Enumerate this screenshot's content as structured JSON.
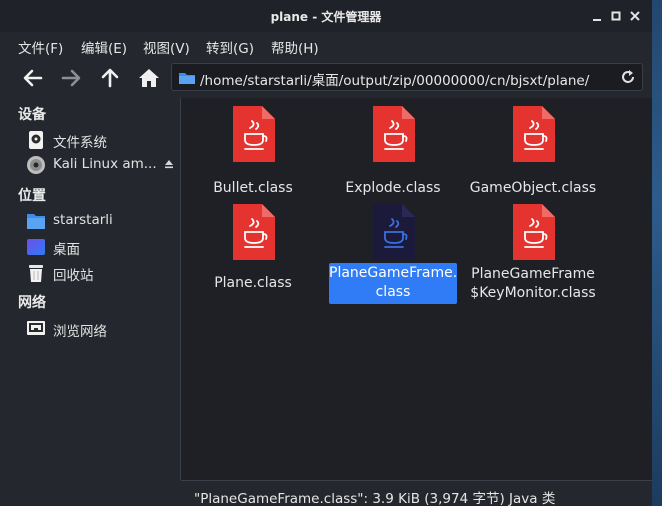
{
  "window": {
    "title": "plane - 文件管理器"
  },
  "menu": [
    "文件(F)",
    "编辑(E)",
    "视图(V)",
    "转到(G)",
    "帮助(H)"
  ],
  "location": {
    "path": "/home/starstarli/桌面/output/zip/00000000/cn/bjsxt/plane/"
  },
  "sidebar": {
    "devices_heading": "设备",
    "devices": [
      {
        "label": "文件系统",
        "icon": "harddrive-icon"
      },
      {
        "label": "Kali Linux am...",
        "icon": "optical-disc-icon"
      }
    ],
    "places_heading": "位置",
    "places": [
      {
        "label": "starstarli",
        "icon": "home-folder-icon"
      },
      {
        "label": "桌面",
        "icon": "desktop-icon"
      },
      {
        "label": "回收站",
        "icon": "trash-icon"
      }
    ],
    "network_heading": "网络",
    "network": [
      {
        "label": "浏览网络",
        "icon": "network-icon"
      }
    ]
  },
  "files": [
    {
      "name": "Bullet.class",
      "selected": false
    },
    {
      "name": "Explode.class",
      "selected": false
    },
    {
      "name": "GameObject.class",
      "selected": false
    },
    {
      "name": "Plane.class",
      "selected": false
    },
    {
      "name_line1": "PlaneGameFrame.",
      "name_line2": "class",
      "selected": true
    },
    {
      "name_line1": "PlaneGameFrame",
      "name_line2": "$KeyMonitor.class",
      "selected": false
    }
  ],
  "status": {
    "text": "\"PlaneGameFrame.class\": 3.9 KiB (3,974 字节) Java 类"
  },
  "colors": {
    "accent": "#2f7cf6",
    "java_file": "#e5342f",
    "selected_icon": "#1c1a3a"
  }
}
